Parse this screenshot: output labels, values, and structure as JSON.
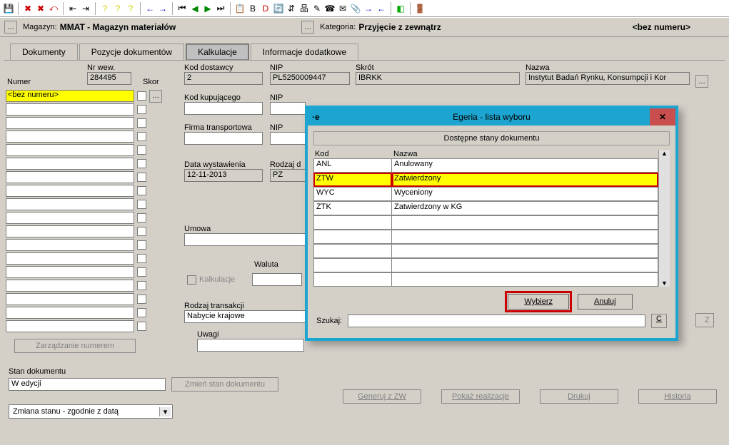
{
  "toolbar_icons": [
    "save",
    "del-row",
    "del-sel",
    "undo",
    "col-left",
    "col-right",
    "find",
    "help1",
    "help2",
    "nav-left",
    "nav-right",
    "first",
    "prev",
    "play",
    "next",
    "last",
    "copy",
    "bold",
    "red-d",
    "refresh",
    "tree1",
    "tree2",
    "edit",
    "phone",
    "mail",
    "clip",
    "arr-left",
    "arr-right",
    "green",
    "exit"
  ],
  "header": {
    "mag_label": "Magazyn:",
    "mag_value": "MMAT - Magazyn materiałów",
    "kat_label": "Kategoria:",
    "kat_value": "Przyjęcie z zewnątrz",
    "beznum": "<bez numeru>"
  },
  "tabs": [
    "Dokumenty",
    "Pozycje dokumentów",
    "Kalkulacje",
    "Informacje dodatkowe"
  ],
  "active_tab": 2,
  "left": {
    "nrwew_label": "Nr wew.",
    "nrwew_value": "284495",
    "numer_label": "Numer",
    "skor_label": "Skor",
    "first_numer": "<bez numeru>",
    "zarzadzanie_btn": "Zarządzanie numerem"
  },
  "form": {
    "kod_dost_label": "Kod dostawcy",
    "kod_dost_value": "2",
    "nip_label": "NIP",
    "nip_value": "PL5250009447",
    "skrot_label": "Skrót",
    "skrot_value": "IBRKK",
    "nazwa_label": "Nazwa",
    "nazwa_value": "Instytut Badań Rynku, Konsumpcji i Kor",
    "kod_kup_label": "Kod kupującego",
    "firma_tr_label": "Firma transportowa",
    "data_wyst_label": "Data wystawienia",
    "data_wyst_value": "12-11-2013",
    "rodzaj_label": "Rodzaj d",
    "rodzaj_value": "PZ",
    "umowa_label": "Umowa",
    "waluta_label": "Waluta",
    "kalkulacje_chk": "Kalkulacje",
    "rodz_trans_label": "Rodzaj transakcji",
    "rodz_trans_value": "Nabycie krajowe",
    "uwagi_label": "Uwagi",
    "z_btn": "Z"
  },
  "stan": {
    "label": "Stan dokumentu",
    "value": "W edycji",
    "zmien_btn": "Zmień stan dokumentu",
    "combo_value": "Zmiana stanu - zgodnie z datą"
  },
  "bottom_buttons": [
    "Generuj z ZW",
    "Pokaż realizacje",
    "Drukuj",
    "Historia"
  ],
  "modal": {
    "title": "Egeria - lista wyboru",
    "section": "Dostępne stany dokumentu",
    "col_kod": "Kod",
    "col_nazwa": "Nazwa",
    "rows": [
      {
        "kod": "ANL",
        "nazwa": "Anulowany"
      },
      {
        "kod": "ZTW",
        "nazwa": "Zatwierdzony"
      },
      {
        "kod": "WYC",
        "nazwa": "Wyceniony"
      },
      {
        "kod": "ZTK",
        "nazwa": "Zatwierdzony w KG"
      }
    ],
    "selected_index": 1,
    "wybierz": "Wybierz",
    "anuluj": "Anuluj",
    "szukaj_label": "Szukaj:",
    "c_btn": "C"
  }
}
